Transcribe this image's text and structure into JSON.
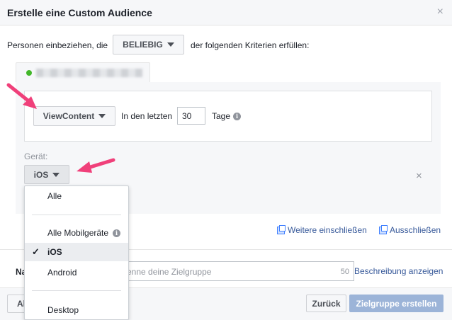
{
  "dialog": {
    "title": "Erstelle eine Custom Audience",
    "close_symbol": "×"
  },
  "criteria": {
    "prefix": "Personen einbeziehen, die",
    "match_dropdown": "BELIEBIG",
    "suffix": "der folgenden Kriterien erfüllen:"
  },
  "rule": {
    "event_dropdown": "ViewContent",
    "in_last_label": "In den letzten",
    "days_value": "30",
    "days_label": "Tage"
  },
  "device": {
    "label": "Gerät:",
    "dropdown_value": "iOS",
    "clear_symbol": "×",
    "options": [
      "Alle",
      "Alle Mobilgeräte",
      "iOS",
      "Android",
      "Desktop"
    ],
    "selected": "iOS"
  },
  "links": {
    "include_more": "Weitere einschließen",
    "exclude": "Ausschließen",
    "show_description": "Beschreibung anzeigen"
  },
  "name_field": {
    "label": "Na",
    "placeholder": "enne deine Zielgruppe",
    "char_count": "50"
  },
  "footer": {
    "cancel_partial": "Al",
    "back_button": "Zurück",
    "create_button": "Zielgruppe erstellen"
  },
  "colors": {
    "accent_link": "#365899",
    "primary_disabled": "#9cb4d8",
    "pointer_arrow": "#f0407a",
    "pixel_status": "#42b72a"
  }
}
